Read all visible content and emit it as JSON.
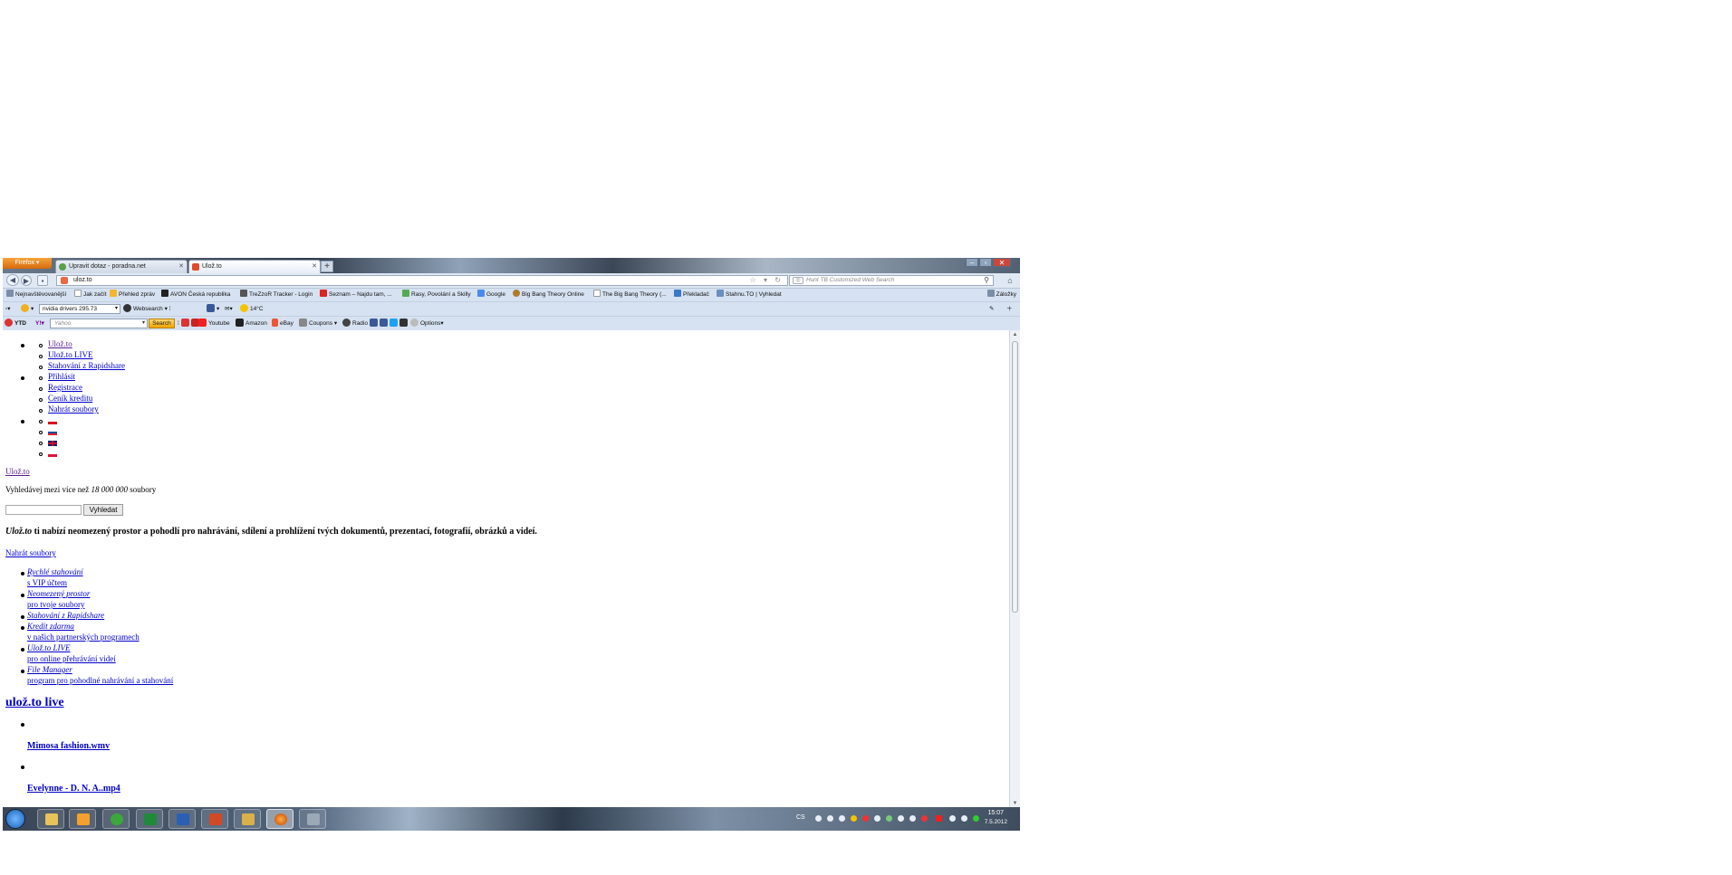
{
  "browser": {
    "menu_label": "Firefox ▾",
    "tabs": [
      {
        "title": "Upravit dotaz - poradna.net"
      },
      {
        "title": "Ulož.to"
      }
    ],
    "new_tab": "+",
    "url": "uloz.to",
    "websearch_placeholder": "Hunt TB Customized Web Search"
  },
  "bookmarks": [
    "Nejnavštěvovanější",
    "Jak začít",
    "Přehled zpráv",
    "AVON Česká republika",
    "TreZzoR Tracker - Login",
    "Seznam – Najdu tam, ...",
    "Rasy, Povolání a Skilly",
    "Google",
    "Big Bang Theory Online",
    "The Big Bang Theory (...",
    "Překladač",
    "Stahnu.TO | Vyhledat"
  ],
  "bookmarks_right": "Záložky",
  "toolbar1": {
    "search_value": "nvidia drivers 295.73",
    "websearch": "Websearch",
    "weather": "14°C"
  },
  "toolbar2": {
    "ytd": "YTD",
    "yahoo_placeholder": "Yahoo",
    "search_btn": "Search",
    "links": [
      "Youtube",
      "Amazon",
      "eBay",
      "Coupons",
      "Radio"
    ],
    "options": "Options"
  },
  "page": {
    "nav_group1": [
      "Ulož.to",
      "Ulož.to LIVE",
      "Stahování z Rapidshare"
    ],
    "nav_group2": [
      "Přihlásit",
      "Registrace",
      "Ceník kreditu",
      "Nahrát soubory"
    ],
    "logo_link": "Ulož.to",
    "search_text_pre": "Vyhledávej mezi více než",
    "search_text_count": "18 000 000",
    "search_text_post": "soubory",
    "search_button": "Vyhledat",
    "tagline_brand": "Ulož.to",
    "tagline": "ti nabízí neomezený prostor a pohodlí pro nahrávání, sdílení a prohlížení tvých dokumentů, prezentací, fotografií, obrázků a videí.",
    "upload_link": "Nahrát soubory",
    "features": [
      {
        "title": "Rychlé stahování",
        "sub": "s VIP účtem"
      },
      {
        "title": "Neomezený prostor",
        "sub": "pro tvoje soubory"
      },
      {
        "title": "Stahování z Rapidshare",
        "sub": ""
      },
      {
        "title": "Kredit zdarma",
        "sub": "v našich partnerských programech"
      },
      {
        "title": "Ulož.to LIVE",
        "sub": "pro online přehrávání videí"
      },
      {
        "title": "File Manager",
        "sub": "program pro pohodlné nahrávání a stahování"
      }
    ],
    "live_heading": "ulož.to live",
    "videos": [
      "Mimosa fashion.wmv",
      "Evelynne - D. N. A..mp4"
    ]
  },
  "taskbar": {
    "lang": "CS",
    "time": "15:07",
    "date": "7.5.2012"
  },
  "colors": {
    "link": "#0000cc",
    "visited": "#551a8b",
    "chrome": "#d6e2f1",
    "firefox_orange": "#e97d17"
  }
}
